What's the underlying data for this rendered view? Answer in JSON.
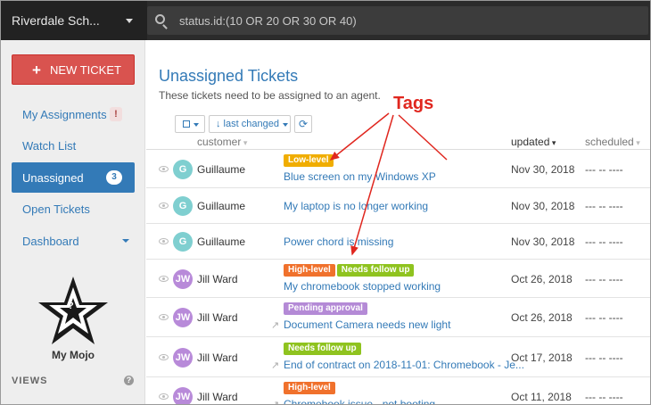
{
  "header": {
    "org_name": "Riverdale Sch...",
    "search_value": "status.id:(10 OR 20 OR 30 OR 40)"
  },
  "sidebar": {
    "new_ticket_label": "NEW TICKET",
    "items": [
      {
        "label": "My Assignments",
        "badge": "!"
      },
      {
        "label": "Watch List"
      },
      {
        "label": "Unassigned",
        "badge": "3",
        "active": true
      },
      {
        "label": "Open Tickets"
      },
      {
        "label": "Dashboard"
      }
    ],
    "mojo_label": "My Mojo",
    "mojo_glyph": "?",
    "views_label": "VIEWS",
    "help_glyph": "?"
  },
  "main": {
    "title": "Unassigned Tickets",
    "subtitle": "These tickets need to be assigned to an agent.",
    "sort_label": "↓ last changed",
    "refresh_glyph": "⟳",
    "columns": {
      "customer": "customer",
      "updated": "updated",
      "scheduled": "scheduled"
    },
    "tickets": [
      {
        "initials": "G",
        "customer": "Guillaume",
        "tags": [
          {
            "text": "Low-level",
            "color": "#f0ad00"
          }
        ],
        "title": "Blue screen on my Windows XP",
        "updated": "Nov 30, 2018",
        "scheduled": "--- -- ----"
      },
      {
        "initials": "G",
        "customer": "Guillaume",
        "tags": [],
        "title": "My laptop is no longer working",
        "updated": "Nov 30, 2018",
        "scheduled": "--- -- ----"
      },
      {
        "initials": "G",
        "customer": "Guillaume",
        "tags": [],
        "title": "Power chord is missing",
        "updated": "Nov 30, 2018",
        "scheduled": "--- -- ----"
      },
      {
        "initials": "JW",
        "customer": "Jill Ward",
        "tags": [
          {
            "text": "High-level",
            "color": "#f0712c"
          },
          {
            "text": "Needs follow up",
            "color": "#8fc31f"
          }
        ],
        "title": "My chromebook stopped working",
        "updated": "Oct 26, 2018",
        "scheduled": "--- -- ----"
      },
      {
        "initials": "JW",
        "customer": "Jill Ward",
        "tags": [
          {
            "text": "Pending approval",
            "color": "#b48ad6"
          }
        ],
        "title": "Document Camera needs new light",
        "updated": "Oct 26, 2018",
        "scheduled": "--- -- ----"
      },
      {
        "initials": "JW",
        "customer": "Jill Ward",
        "tags": [
          {
            "text": "Needs follow up",
            "color": "#8fc31f"
          }
        ],
        "title": "End of contract on 2018-11-01: Chromebook - Je...",
        "updated": "Oct 17, 2018",
        "scheduled": "--- -- ----"
      },
      {
        "initials": "JW",
        "customer": "Jill Ward",
        "tags": [
          {
            "text": "High-level",
            "color": "#f0712c"
          }
        ],
        "title": "Chromebook issue - not booting",
        "updated": "Oct 11, 2018",
        "scheduled": "--- -- ----"
      }
    ]
  },
  "annotation": {
    "label": "Tags",
    "color": "#e0271f"
  },
  "colors": {
    "accent": "#337ab7",
    "new_ticket": "#d9534f",
    "avatar_g": "#7fcfd0",
    "avatar_jw": "#b88ad9"
  }
}
